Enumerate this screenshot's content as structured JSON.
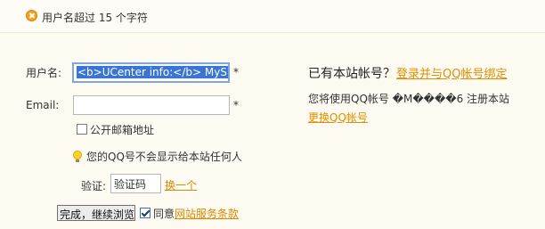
{
  "notice": {
    "icon": "warning-icon",
    "text": "用户名超过 15 个字符"
  },
  "form": {
    "username_label": "用户名:",
    "username_value_bold_open": "<b>",
    "username_value_text": "UCenter info:",
    "username_value_bold_close": "</b>",
    "username_value_tail": "MyS",
    "required_mark": "*",
    "email_label": "Email:",
    "email_value": "",
    "public_email_label": "公开邮箱地址",
    "qq_hint": "您的QQ号不会显示给本站任何人",
    "captcha_label": "验证:",
    "captcha_placeholder": "验证码",
    "captcha_change_link": "换一个",
    "submit_button": "完成，继续浏览",
    "agree_label": "同意",
    "terms_link": "网站服务条款"
  },
  "side": {
    "title": "已有本站帐号？",
    "bind_link": "登录并与QQ帐号绑定",
    "notice_text": "您将使用QQ帐号 �M����6 注册本站",
    "change_link": "更换QQ帐号"
  },
  "colors": {
    "accent": "#e08f00",
    "background": "#fdfaf2",
    "selection": "#3875d7"
  }
}
